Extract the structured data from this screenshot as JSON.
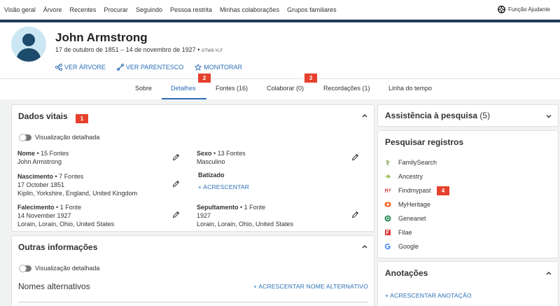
{
  "topnav": {
    "items": [
      "Visão geral",
      "Árvore",
      "Recentes",
      "Procurar",
      "Seguindo",
      "Pessoa restrita",
      "Minhas colaborações",
      "Grupos familiares"
    ],
    "helper_label": "Função Ajudante"
  },
  "person": {
    "name": "John Armstrong",
    "dates": "17 de outubro de 1851 – 14 de novembro de 1927",
    "pid": "GTW8-YLF"
  },
  "actions": {
    "view_tree": "VER ÁRVORE",
    "view_relationship": "VER PARENTESCO",
    "watch": "MONITORAR"
  },
  "tabs": {
    "about": "Sobre",
    "details": "Detalhes",
    "sources": "Fontes (16)",
    "collaborate": "Colaborar (0)",
    "memories": "Recordações (1)",
    "timeline": "Linha do tempo"
  },
  "badges": {
    "b1": "1",
    "b2": "2",
    "b3": "3",
    "b4": "4"
  },
  "vitals": {
    "title": "Dados vitais",
    "detail_toggle": "Visualização detalhada",
    "name": {
      "label": "Nome",
      "count": " • 15 Fontes",
      "value": "John Armstrong"
    },
    "sex": {
      "label": "Sexo",
      "count": " • 13 Fontes",
      "value": "Masculino"
    },
    "birth": {
      "label": "Nascimento",
      "count": " • 7 Fontes",
      "date": "17 October 1851",
      "place": "Kiplin, Yorkshire, England, United Kingdom"
    },
    "christening": {
      "label": "Batizado",
      "add": "+ ACRESCENTAR"
    },
    "death": {
      "label": "Falecimento",
      "count": " • 1 Fonte",
      "date": "14 November 1927",
      "place": "Lorain, Lorain, Ohio, United States"
    },
    "burial": {
      "label": "Sepultamento",
      "count": " • 1 Fonte",
      "date": "1927",
      "place": "Lorain, Lorain, Ohio, United States"
    }
  },
  "other": {
    "title": "Outras informações",
    "detail_toggle": "Visualização detalhada",
    "alt_names": "Nomes alternativos",
    "add_alt_name": "+ ACRESCENTAR NOME ALTERNATIVO"
  },
  "research_help": {
    "title": "Assistência à pesquisa",
    "count": "(5)"
  },
  "search_records": {
    "title": "Pesquisar registros",
    "items": [
      {
        "label": "FamilySearch",
        "icon": "familysearch-tree-icon",
        "color": "#7a9a3a"
      },
      {
        "label": "Ancestry",
        "icon": "ancestry-leaf-icon",
        "color": "#8bb23a"
      },
      {
        "label": "Findmypast",
        "icon": "findmypast-icon",
        "color": "#d9534f"
      },
      {
        "label": "MyHeritage",
        "icon": "myheritage-icon",
        "color": "#f26b2a"
      },
      {
        "label": "Geneanet",
        "icon": "geneanet-icon",
        "color": "#2e8b57"
      },
      {
        "label": "Filae",
        "icon": "filae-icon",
        "color": "#e23b3b"
      },
      {
        "label": "Google",
        "icon": "google-icon",
        "color": "#4285f4"
      }
    ]
  },
  "notes": {
    "title": "Anotações",
    "add": "+ ACRESCENTAR ANOTAÇÃO"
  }
}
